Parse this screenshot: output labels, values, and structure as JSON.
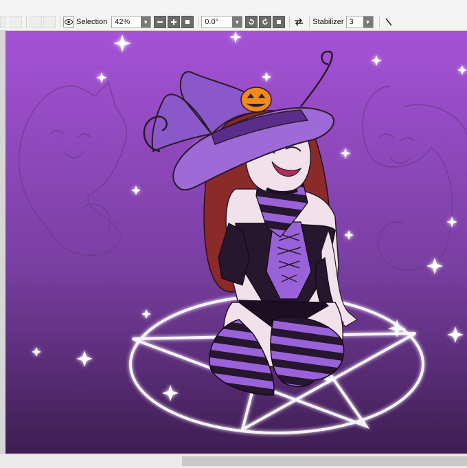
{
  "toolbar": {
    "selection_label": "Selection",
    "zoom_value": "42%",
    "angle_value": "0.0°",
    "stabilizer_label": "Stabilizer",
    "stabilizer_value": "3",
    "zoom_out_icon": "minus-icon",
    "zoom_in_icon": "plus-icon",
    "rotate_left_icon": "rotate-left-icon",
    "rotate_right_icon": "rotate-right-icon",
    "flip_icon": "flip-horizontal-icon",
    "pen_icon": "pen-line-icon"
  },
  "colors": {
    "canvas_top": "#a552d6",
    "canvas_bottom": "#3e1d52",
    "hat": "#9d6ad8",
    "stripe_dark": "#26162e",
    "stripe_light": "#9a62d9",
    "hair": "#8a2a2a",
    "pentagram": "#ffffff"
  }
}
